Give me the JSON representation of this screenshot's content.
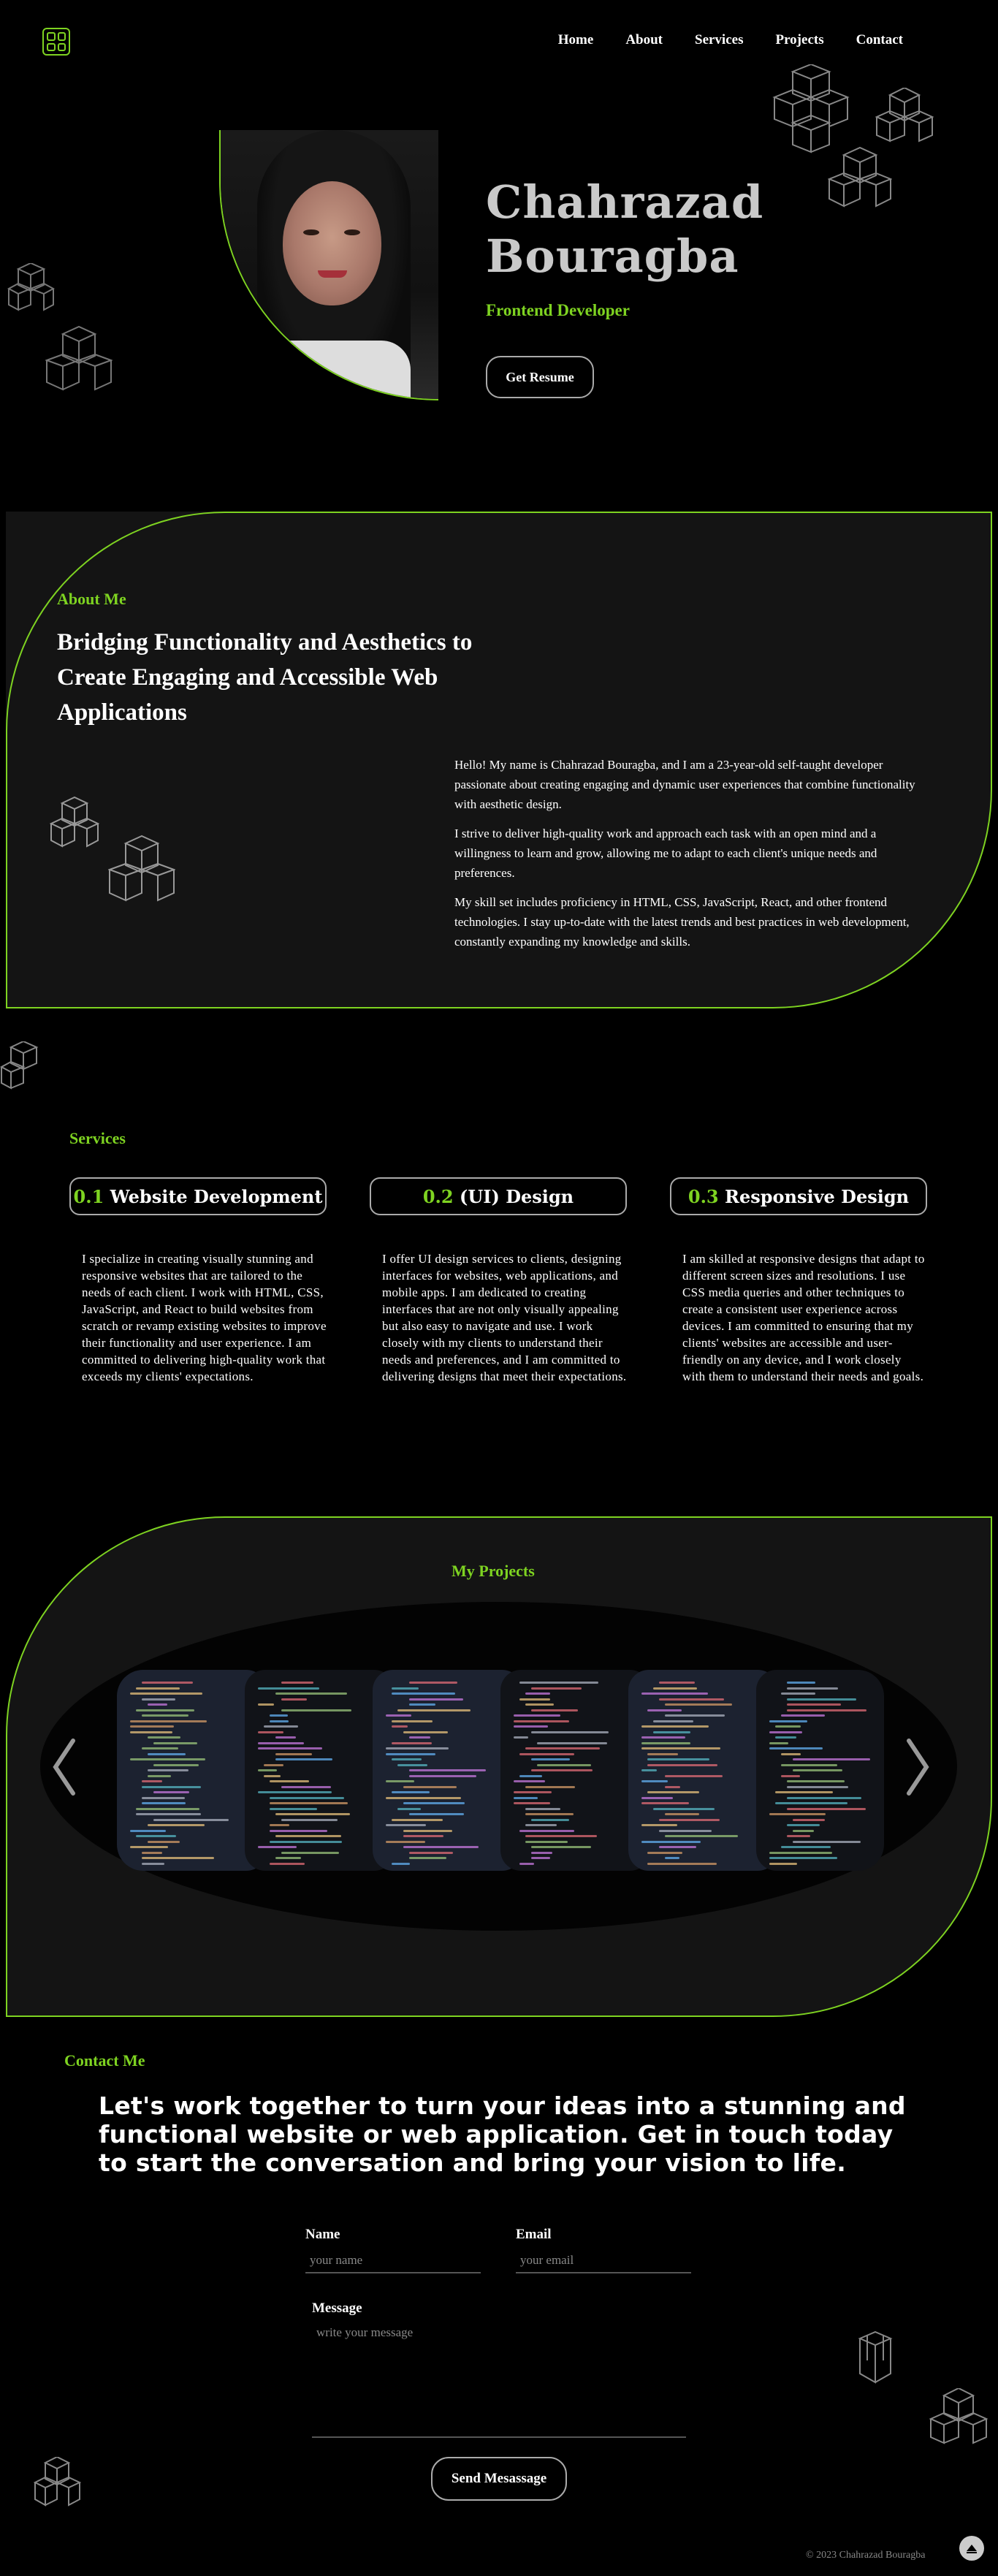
{
  "nav": {
    "items": [
      "Home",
      "About",
      "Services",
      "Projects",
      "Contact"
    ]
  },
  "hero": {
    "name_line1": "Chahrazad",
    "name_line2": "Bouragba",
    "role": "Frontend Developer",
    "resume_button": "Get Resume"
  },
  "about": {
    "label": "About Me",
    "heading": "Bridging Functionality and Aesthetics to Create Engaging and Accessible Web Applications",
    "paragraphs": [
      "Hello! My name is Chahrazad Bouragba, and I am a 23-year-old self-taught developer passionate about creating engaging and dynamic user experiences that combine functionality with aesthetic design.",
      "I strive to deliver high-quality work and approach each task with an open mind and a willingness to learn and grow, allowing me to adapt to each client's unique needs and preferences.",
      "My skill set includes proficiency in HTML, CSS, JavaScript, React, and other frontend technologies. I stay up-to-date with the latest trends and best practices in web development, constantly expanding my knowledge and skills."
    ]
  },
  "services": {
    "label": "Services",
    "items": [
      {
        "number": "0.1",
        "title": "Website Development",
        "body": "I specialize in creating visually stunning and responsive websites that are tailored to the needs of each client. I work with HTML, CSS, JavaScript, and React to build websites from scratch or revamp existing websites to improve their functionality and user experience. I am committed to delivering high-quality work that exceeds my clients' expectations."
      },
      {
        "number": "0.2",
        "title": "(UI) Design",
        "body": "I offer UI design services to clients, designing interfaces for websites, web applications, and mobile apps. I am dedicated to creating interfaces that are not only visually appealing but also easy to navigate and use. I work closely with my clients to understand their needs and preferences, and I am committed to delivering designs that meet their expectations."
      },
      {
        "number": "0.3",
        "title": "Responsive Design",
        "body": "I am skilled at responsive designs that adapt to different screen sizes and resolutions. I use CSS media queries and other techniques to create a consistent user experience across devices. I am committed to ensuring that my clients' websites are accessible and user-friendly on any device, and I work closely with them to understand their needs and goals."
      }
    ]
  },
  "projects": {
    "label": "My Projects",
    "slide_count": 6
  },
  "contact": {
    "label": "Contact Me",
    "lead": "Let's work together to turn your ideas into a stunning and functional website or web application. Get in touch today to start the conversation and bring your vision to life.",
    "name_label": "Name",
    "name_placeholder": "your name",
    "email_label": "Email",
    "email_placeholder": "your email",
    "message_label": "Message",
    "message_placeholder": "write your message",
    "send_button": "Send Mesassage"
  },
  "footer": {
    "copyright": "© 2023 Chahrazad Bouragba"
  },
  "colors": {
    "accent": "#7ed321",
    "panel": "#141414",
    "background": "#000000"
  }
}
